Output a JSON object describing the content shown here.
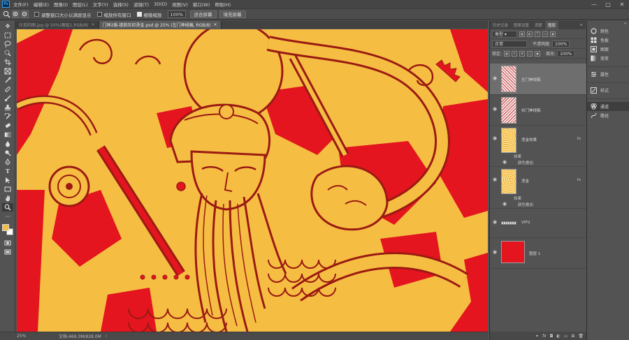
{
  "app": {
    "logo": "Ps"
  },
  "menu": [
    "文件(F)",
    "编辑(E)",
    "图像(I)",
    "图层(L)",
    "文字(Y)",
    "选择(S)",
    "滤镜(T)",
    "3D(D)",
    "视图(V)",
    "窗口(W)",
    "帮助(H)"
  ],
  "window_controls": {
    "minimize": "—",
    "maximize": "□",
    "close": "✕"
  },
  "options": {
    "resize_windows": "调整窗口大小以满屏显示",
    "zoom_all": "缩放所有窗口",
    "scrubby_zoom": "细微缩放",
    "zoom_value": "100%",
    "fit_screen": "适合屏幕",
    "fill_screen": "填充屏幕"
  },
  "tabs": [
    {
      "label": "仕茄的图.jpg @ 50%(图层1,RGB/8)",
      "active": false
    },
    {
      "label": "门神2版-搓脸压印烫金.psd @ 25% (左门神线稿, RGB/8)",
      "active": true
    }
  ],
  "status": {
    "zoom": "25%",
    "doc": "文档:469.3M/828.0M"
  },
  "layers_panel": {
    "tabs": [
      "历史记录",
      "图案设置",
      "调整",
      "图层"
    ],
    "active_tab": "图层",
    "kind": "类型",
    "blend_mode": "正常",
    "opacity_label": "不透明度:",
    "opacity": "100%",
    "lock_label": "锁定:",
    "fill_label": "填充:",
    "fill": "100%",
    "layers": [
      {
        "name": "左门神线稿",
        "type": "red-line",
        "selected": true
      },
      {
        "name": "右门神线稿",
        "type": "red-line",
        "selected": false
      },
      {
        "name": "烫金效果",
        "type": "gold",
        "fx": "fx",
        "effects_label": "效果",
        "effect": "颜色叠加"
      },
      {
        "name": "烫金",
        "type": "gold",
        "fx": "fx",
        "effects_label": "效果",
        "effect": "颜色叠加"
      },
      {
        "name": "VIFU",
        "type": "strip",
        "fx": ""
      },
      {
        "name": "图层 1",
        "type": "red",
        "fx": ""
      }
    ],
    "footer_icons": [
      "link-icon",
      "fx-icon",
      "mask-icon",
      "adjust-icon",
      "folder-icon",
      "new-layer-icon",
      "trash-icon"
    ]
  },
  "right_panel": {
    "items": [
      "颜色",
      "色板",
      "图案",
      "渐变",
      "属性",
      "样式",
      "通道",
      "路径"
    ],
    "active": "通道"
  },
  "colors": {
    "canvas_gold": "#f5be43",
    "canvas_red": "#e4151e",
    "line_dark": "#9b1a12"
  }
}
